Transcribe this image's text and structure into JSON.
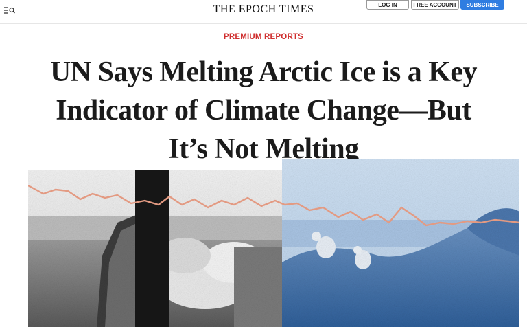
{
  "header": {
    "logo": "THE EPOCH TIMES",
    "login_label": "LOG IN",
    "free_account_label": "FREE ACCOUNT",
    "subscribe_label": "SUBSCRIBE",
    "menu_icon": "menu-search-icon"
  },
  "article": {
    "section": "PREMIUM REPORTS",
    "headline": "UN Says Melting Arctic Ice is a Key Indicator of Climate Change—But It’s Not Melting"
  },
  "colors": {
    "section_red": "#cf2e2e",
    "subscribe_blue": "#2f7de1",
    "trend_line": "#e39a82",
    "ice_blue": "#8fb6de"
  }
}
